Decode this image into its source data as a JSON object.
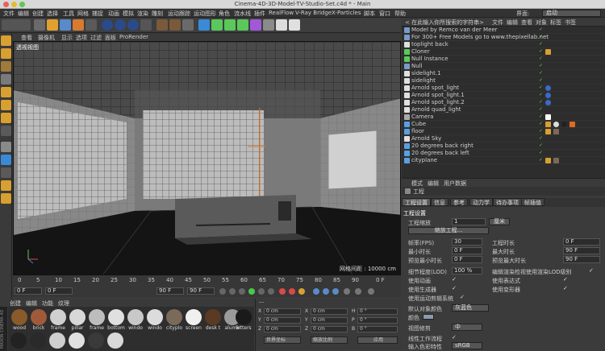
{
  "window": {
    "title": "Cinema-4D-3D-Model-TV-Studio-Set.c4d * - Main"
  },
  "menu": {
    "items": [
      "文件",
      "编辑",
      "创建",
      "选择",
      "工具",
      "网格",
      "捕捉",
      "动画",
      "模拟",
      "渲染",
      "雕刻",
      "运动跟踪",
      "运动图形",
      "角色",
      "流水线",
      "插件",
      "RealFlow",
      "V-Ray Bridge",
      "X-Particles",
      "脚本",
      "窗口",
      "帮助"
    ],
    "layout_label": "界面:",
    "layout_value": "启动"
  },
  "viewport": {
    "menu": [
      "查看",
      "摄像机",
      "显示",
      "选项",
      "过滤",
      "面板",
      "ProRender"
    ],
    "name": "透视视图",
    "grid_spacing": "网格间距 : 10000 cm"
  },
  "timeline": {
    "ticks": [
      "0",
      "5",
      "10",
      "15",
      "20",
      "25",
      "30",
      "35",
      "40",
      "45",
      "50",
      "55",
      "60",
      "65",
      "70",
      "75",
      "80",
      "85",
      "90"
    ],
    "current_frame": "0 F",
    "start": "0 F",
    "start2": "0 F",
    "end": "90 F",
    "end2": "90 F"
  },
  "materials": {
    "menu": [
      "创建",
      "编辑",
      "功能",
      "纹理"
    ],
    "items": [
      {
        "label": "wood",
        "color": "#8a5a2a"
      },
      {
        "label": "brick",
        "color": "#a05a3a"
      },
      {
        "label": "frame",
        "color": "#cfcfcf"
      },
      {
        "label": "pillar",
        "color": "#d8d8d8"
      },
      {
        "label": "frame",
        "color": "#bdbdbd"
      },
      {
        "label": "bottom",
        "color": "#e0e0e0"
      },
      {
        "label": "windo",
        "color": "#c8c8c8"
      },
      {
        "label": "windo",
        "color": "#dcdcdc"
      },
      {
        "label": "cityplo",
        "color": "#7a6a5a"
      },
      {
        "label": "screen",
        "color": "#f0f0f0"
      },
      {
        "label": "desk t",
        "color": "#5a3a22"
      },
      {
        "label": "alumir",
        "color": "#9a9a9a"
      },
      {
        "label": "letters",
        "color": "#1a1a1a"
      }
    ],
    "brand": "MAXON CINEMA 4D"
  },
  "coordinates": {
    "header": "---",
    "rows": [
      {
        "a": "X",
        "av": "0 cm",
        "b": "X",
        "bv": "0 cm",
        "c": "H",
        "cv": "0 °"
      },
      {
        "a": "Y",
        "av": "0 cm",
        "b": "Y",
        "bv": "0 cm",
        "c": "P",
        "cv": "0 °"
      },
      {
        "a": "Z",
        "av": "0 cm",
        "b": "Z",
        "bv": "0 cm",
        "c": "B",
        "cv": "0 °"
      }
    ],
    "mode": "世界坐标",
    "scale": "缩放比例",
    "apply": "应用"
  },
  "objects": {
    "menu": [
      "< 在此输入你所搜索的字符串>",
      "文件",
      "编辑",
      "查看",
      "对象",
      "标签",
      "书签"
    ],
    "rows": [
      {
        "name": "Model by Remco van der Meer",
        "icon": "#7a9ac8"
      },
      {
        "name": "For 300+ Free Models go to www.thepixellab.net",
        "icon": "#7a9ac8"
      },
      {
        "name": "toplight back",
        "icon": "#e0e0e0"
      },
      {
        "name": "Cloner",
        "icon": "#5ac85a"
      },
      {
        "name": "Null Instance",
        "icon": "#5ac85a"
      },
      {
        "name": "Null",
        "icon": "#7a9ac8"
      },
      {
        "name": "sidelight.1",
        "icon": "#e0e0e0"
      },
      {
        "name": "sidelight",
        "icon": "#e0e0e0"
      },
      {
        "name": "Arnold spot_light",
        "icon": "#e0e0e0"
      },
      {
        "name": "Arnold spot_light.1",
        "icon": "#e0e0e0"
      },
      {
        "name": "Arnold spot_light.2",
        "icon": "#e0e0e0"
      },
      {
        "name": "Arnold quad_light",
        "icon": "#e0e0e0"
      },
      {
        "name": "Camera",
        "icon": "#aaaaaa"
      },
      {
        "name": "Cube",
        "icon": "#5aa0e0"
      },
      {
        "name": "floor",
        "icon": "#5aa0e0"
      },
      {
        "name": "Arnold Sky",
        "icon": "#e0e0e0"
      },
      {
        "name": "20 degrees back right",
        "icon": "#5aa0e0"
      },
      {
        "name": "20 degrees back left",
        "icon": "#5aa0e0"
      },
      {
        "name": "cityplane",
        "icon": "#5aa0e0"
      }
    ]
  },
  "attributes": {
    "tabs": [
      "模式",
      "编辑",
      "用户数据"
    ],
    "title": "工程",
    "subtabs": [
      "工程设置",
      "信息",
      "参考",
      "动力学",
      "待办事项",
      "帧插值"
    ],
    "section": "工程设置",
    "scale_label": "工程缩放",
    "scale_value": "1",
    "scale_unit": "厘米",
    "scale_button": "缩放工程...",
    "fps_label": "帧率(FPS)",
    "fps_value": "30",
    "project_length_label": "工程时长",
    "project_length_value": "0 F",
    "min_time_label": "最小时长",
    "min_time_value": "0 F",
    "max_time_label": "最大时长",
    "max_time_value": "90 F",
    "preview_min_label": "预览最小时长",
    "preview_min_value": "0 F",
    "preview_max_label": "预览最大时长",
    "preview_max_value": "90 F",
    "lod_label": "细节程度(LOD)",
    "lod_value": "100 %",
    "render_lod_label": "编辑渲染检视使用渲染LOD级别",
    "use_anim_label": "使用动画",
    "use_expr_label": "使用表达式",
    "use_gen_label": "使用生成器",
    "use_deform_label": "使用变形器",
    "use_motion_label": "使用运动剪辑系统",
    "obj_color_label": "默认对象颜色",
    "obj_color_value": "灰蓝色",
    "color_label": "颜色",
    "view_clip_label": "视图修剪",
    "view_clip_value": "中",
    "linear_label": "线性工作流程",
    "input_color_label": "输入色彩特性",
    "input_color_value": "sRGB"
  }
}
